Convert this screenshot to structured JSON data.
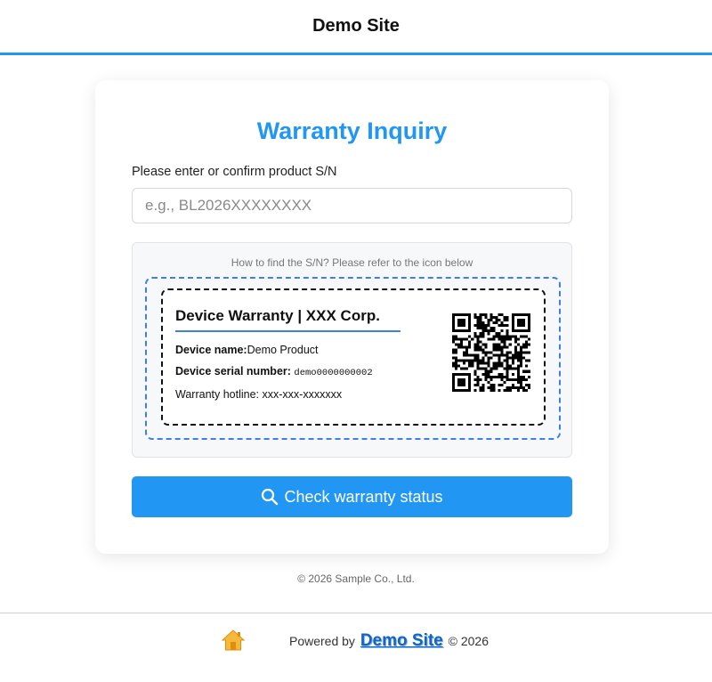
{
  "header": {
    "site_title": "Demo Site",
    "accent_color": "#2196f3"
  },
  "form": {
    "title": "Warranty Inquiry",
    "sn_label": "Please enter or confirm product S/N",
    "sn_placeholder": "e.g., BL2026XXXXXXXX",
    "sn_value": "",
    "help_hint": "How to find the S/N? Please refer to the icon below",
    "submit_label": "Check warranty status",
    "submit_icon": "search-icon"
  },
  "sample_label": {
    "heading": "Device Warranty | XXX Corp.",
    "device_name_label": "Device name:",
    "device_name_value": "Demo Product",
    "serial_label": "Device serial number:",
    "serial_value": "demo0000000002",
    "hotline": "Warranty hotline: xxx-xxx-xxxxxxx",
    "qr_icon": "qr-code-icon"
  },
  "footer": {
    "copyright": "© 2026 Sample Co., Ltd.",
    "home_icon": "home-icon",
    "powered_by": "Powered by",
    "site_link": "Demo Site",
    "year_text": "© 2026"
  }
}
